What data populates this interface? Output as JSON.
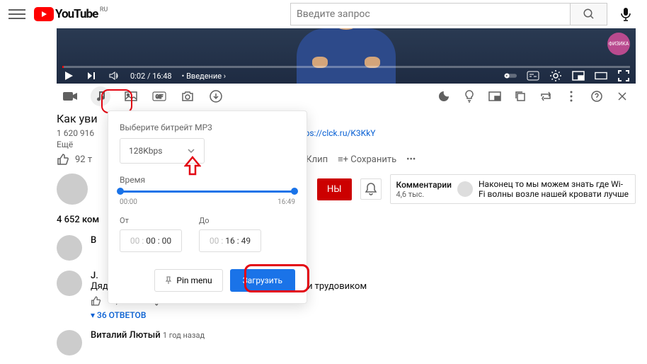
{
  "header": {
    "logo_text": "YouTube",
    "region": "RU",
    "search_placeholder": "Введите запрос"
  },
  "player": {
    "current_time": "0:02",
    "duration": "16:48",
    "chapter": "Введение",
    "channel_badge": "ФИЗИКА"
  },
  "video": {
    "title_visible": "Как уви",
    "views_fragment": "1 620 916",
    "link_visible": "https://clck.ru/K3KkY",
    "more_label": "Ещё",
    "likes_fragment": "92 т",
    "clip_label": "Клип",
    "save_label": "Сохранить",
    "subscribe_fragment": "НЫ",
    "comments_header": "Комментарии",
    "comments_sub": "4,6 тыс.",
    "featured_comment": "Наконец то мы можем знать где Wi-Fi волны возле нашей кровати лучше",
    "comment_count": "4 652 ком"
  },
  "comments": [
    {
      "author_fragment": "В",
      "text_fragment": ""
    },
    {
      "author_fragment": "J.",
      "text": "Дядя Митя: безупречный баланс между физиком и трудовиком",
      "likes": "2,4 тыс.",
      "reply": "ОТВЕТИТЬ",
      "replies": "36 ОТВЕТОВ"
    },
    {
      "author": "Виталий Лютый",
      "time": "1 год назад"
    }
  ],
  "popup": {
    "bitrate_label": "Выберите битрейт MP3",
    "bitrate_value": "128Kbps",
    "time_label": "Время",
    "slider_start": "00:00",
    "slider_end": "16:49",
    "from_label": "От",
    "from_gray": "00 :",
    "from_value": "00 : 00",
    "to_label": "До",
    "to_gray": "00 :",
    "to_value": "16 : 49",
    "pin_label": "Pin menu",
    "download_label": "Загрузить"
  }
}
